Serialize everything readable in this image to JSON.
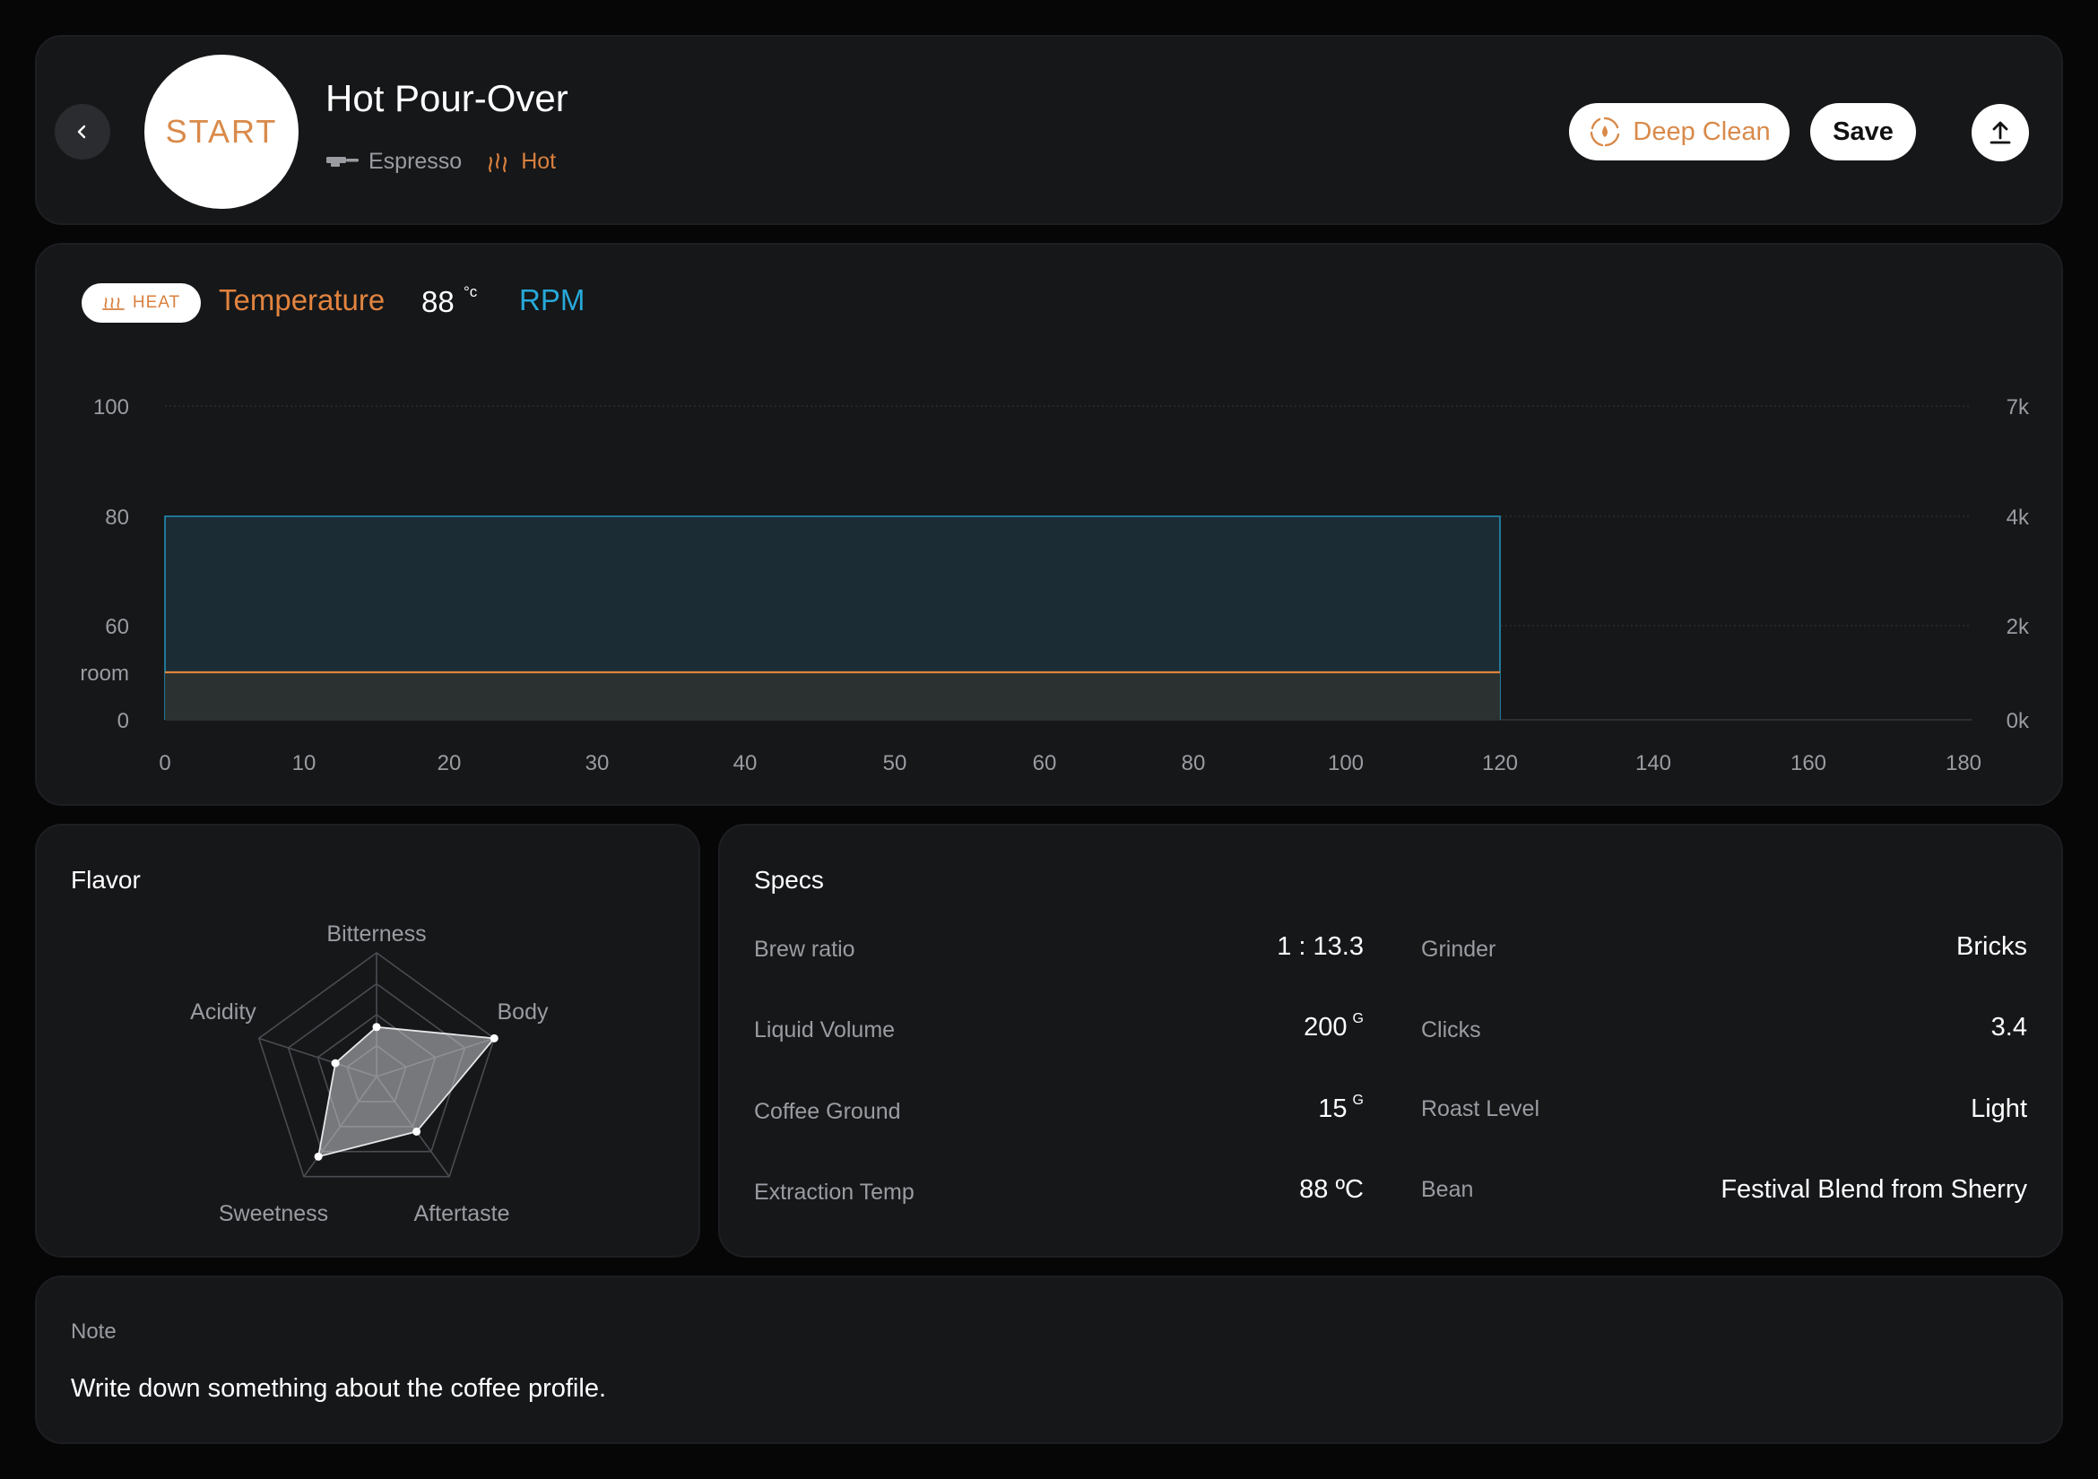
{
  "header": {
    "start_label": "START",
    "title": "Hot Pour-Over",
    "tag_method": "Espresso",
    "tag_temp": "Hot",
    "deep_clean_label": "Deep Clean",
    "save_label": "Save"
  },
  "chart": {
    "heat_label": "HEAT",
    "temp_legend": "Temperature",
    "temp_value": "88",
    "temp_unit": "°c",
    "rpm_legend": "RPM"
  },
  "chart_data": {
    "type": "area",
    "x_ticks": [
      "0",
      "10",
      "20",
      "30",
      "40",
      "50",
      "60",
      "80",
      "100",
      "120",
      "140",
      "160",
      "180"
    ],
    "y_left_ticks": [
      "100",
      "80",
      "60",
      "room",
      "0"
    ],
    "y_right_ticks": [
      "7k",
      "4k",
      "2k",
      "0k"
    ],
    "series": [
      {
        "name": "RPM",
        "color": "#27a9d9",
        "x_start": "0",
        "x_end": "120",
        "level_left_axis": "80"
      },
      {
        "name": "Temperature",
        "color": "#e2843f",
        "x_start": "0",
        "x_end": "120",
        "level_left_axis": "room"
      }
    ],
    "grid": true
  },
  "flavor": {
    "title": "Flavor",
    "axes": [
      "Bitterness",
      "Body",
      "Aftertaste",
      "Sweetness",
      "Acidity"
    ],
    "values": [
      0.4,
      1.0,
      0.55,
      0.8,
      0.35
    ],
    "max": 1
  },
  "specs": {
    "title": "Specs",
    "left": [
      {
        "label": "Brew ratio",
        "value": "1 : 13.3",
        "unit": ""
      },
      {
        "label": "Liquid Volume",
        "value": "200",
        "unit": "G"
      },
      {
        "label": "Coffee Ground",
        "value": "15",
        "unit": "G"
      },
      {
        "label": "Extraction Temp",
        "value": "88 ºC",
        "unit": ""
      }
    ],
    "right": [
      {
        "label": "Grinder",
        "value": "Bricks"
      },
      {
        "label": "Clicks",
        "value": "3.4"
      },
      {
        "label": "Roast Level",
        "value": "Light"
      },
      {
        "label": "Bean",
        "value": "Festival Blend from Sherry"
      }
    ]
  },
  "note": {
    "label": "Note",
    "text": "Write down something about the coffee profile."
  },
  "colors": {
    "accent_orange": "#e2843f",
    "accent_blue": "#27a9d9",
    "card_bg": "#161719",
    "page_bg": "#060607"
  }
}
